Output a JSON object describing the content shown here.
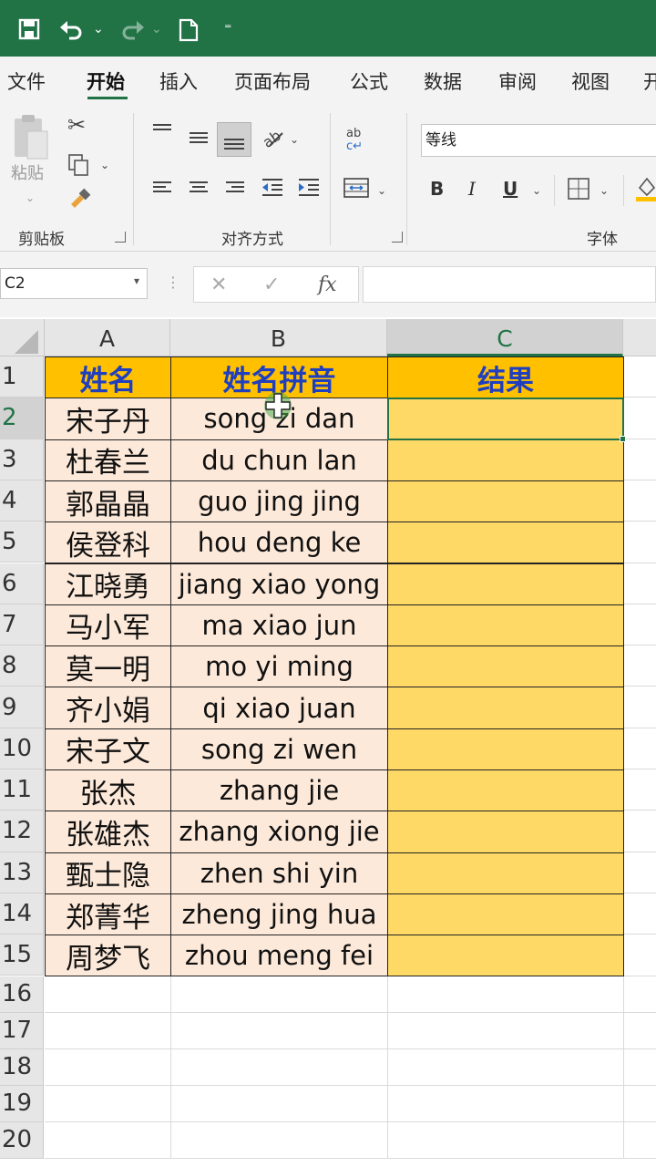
{
  "colors": {
    "title_bar": "#217346",
    "header_fill": "#ffc000",
    "header_text": "#1f3fbf",
    "name_fill": "#fde9d9",
    "result_fill": "#ffd966",
    "accent": "#217346"
  },
  "quick_access": {
    "icons": [
      "save-icon",
      "undo-icon",
      "redo-icon",
      "new-file-icon",
      "customize-icon"
    ]
  },
  "tabs": [
    "文件",
    "开始",
    "插入",
    "页面布局",
    "公式",
    "数据",
    "审阅",
    "视图",
    "开"
  ],
  "active_tab": "开始",
  "ribbon": {
    "clipboard": {
      "label": "剪贴板",
      "paste_label": "粘贴"
    },
    "alignment": {
      "label": "对齐方式"
    },
    "font": {
      "label": "字体",
      "font_name": "等线",
      "bold": "B",
      "italic": "I",
      "underline": "U"
    }
  },
  "formula_bar": {
    "name_box": "C2",
    "cancel": "✕",
    "enter": "✓",
    "fx": "fx",
    "formula": ""
  },
  "columns": [
    "A",
    "B",
    "C"
  ],
  "selected_column": "C",
  "selected_row": "2",
  "row_numbers": [
    "1",
    "2",
    "3",
    "4",
    "5",
    "6",
    "7",
    "8",
    "9",
    "10",
    "11",
    "12",
    "13",
    "14",
    "15",
    "16",
    "17",
    "18",
    "19",
    "20"
  ],
  "table": {
    "headers": [
      "姓名",
      "姓名拼音",
      "结果"
    ],
    "rows": [
      {
        "name": "宋子丹",
        "pinyin": "song zi dan",
        "result": ""
      },
      {
        "name": "杜春兰",
        "pinyin": "du chun lan",
        "result": ""
      },
      {
        "name": "郭晶晶",
        "pinyin": "guo jing jing",
        "result": ""
      },
      {
        "name": "侯登科",
        "pinyin": "hou deng ke",
        "result": ""
      },
      {
        "name": "江晓勇",
        "pinyin": "jiang xiao yong",
        "result": ""
      },
      {
        "name": "马小军",
        "pinyin": "ma xiao jun",
        "result": ""
      },
      {
        "name": "莫一明",
        "pinyin": "mo yi ming",
        "result": ""
      },
      {
        "name": "齐小娟",
        "pinyin": "qi xiao juan",
        "result": ""
      },
      {
        "name": "宋子文",
        "pinyin": "song zi wen",
        "result": ""
      },
      {
        "name": "张杰",
        "pinyin": "zhang jie",
        "result": ""
      },
      {
        "name": "张雄杰",
        "pinyin": "zhang xiong jie",
        "result": ""
      },
      {
        "name": "甄士隐",
        "pinyin": "zhen shi yin",
        "result": ""
      },
      {
        "name": "郑菁华",
        "pinyin": "zheng jing hua",
        "result": ""
      },
      {
        "name": "周梦飞",
        "pinyin": "zhou meng fei",
        "result": ""
      }
    ]
  }
}
